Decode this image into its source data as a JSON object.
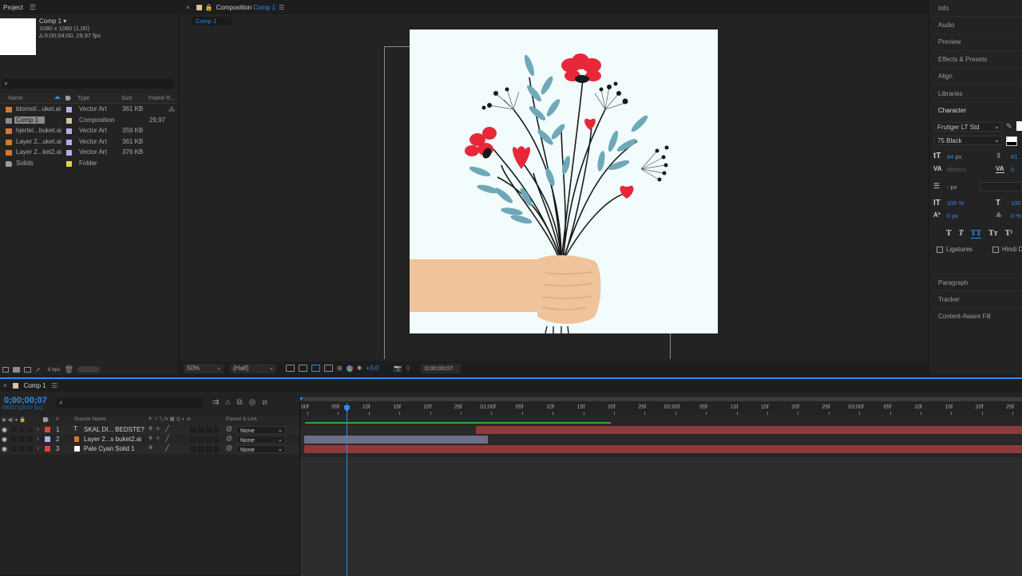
{
  "project": {
    "tab_label": "Project",
    "comp_name": "Comp 1 ▾",
    "comp_res": "1080 x 1080 (1,00)",
    "comp_dur": "Δ 0;00;04;00, 29,97 fps",
    "search_placeholder": "",
    "columns": {
      "name": "Name",
      "type": "Type",
      "size": "Size",
      "frame": "Frame R..."
    },
    "items": [
      {
        "name": "blomst/...uket.ai",
        "type": "Vector Art",
        "size": "361 KB",
        "fr": "",
        "color": "#b0b0e8",
        "icon": "vector-file-icon"
      },
      {
        "name": "Comp 1",
        "type": "Composition",
        "size": "",
        "fr": "29,97",
        "color": "#d8c49c",
        "icon": "composition-icon"
      },
      {
        "name": "hjerte/...buket.ai",
        "type": "Vector Art",
        "size": "359 KB",
        "fr": "",
        "color": "#b0b0e8",
        "icon": "vector-file-icon"
      },
      {
        "name": "Layer 2...uket.ai",
        "type": "Vector Art",
        "size": "361 KB",
        "fr": "",
        "color": "#b0b0e8",
        "icon": "vector-file-icon"
      },
      {
        "name": "Layer 2...ket2.ai",
        "type": "Vector Art",
        "size": "376 KB",
        "fr": "",
        "color": "#b0b0e8",
        "icon": "vector-file-icon"
      },
      {
        "name": "Solids",
        "type": "Folder",
        "size": "",
        "fr": "",
        "color": "#e6d048",
        "icon": "folder-icon"
      }
    ],
    "bpc": "8 bpc"
  },
  "composition": {
    "tab_prefix": "Composition",
    "tab_name": "Comp 1",
    "subtab": "Comp 1",
    "zoom": "50%",
    "resolution": "(Half)",
    "exposure": "+0,0",
    "timecode": "0;00;00;07"
  },
  "right_panels": {
    "items": [
      "Info",
      "Audio",
      "Preview",
      "Effects & Presets",
      "Align",
      "Libraries",
      "Character"
    ],
    "lower_items": [
      "Paragraph",
      "Tracker",
      "Content-Aware Fill"
    ]
  },
  "character": {
    "font": "Frutiger LT Std",
    "style": "75 Black",
    "size": "84",
    "size_unit": "px",
    "leading": "81",
    "kerning": "Metrics",
    "tracking": "0",
    "stroke_unit": "px",
    "stroke_value": "-",
    "v_scale": "100 %",
    "h_scale": "100",
    "baseline": "0 px",
    "tsume": "0 %",
    "style_buttons": [
      "T",
      "T",
      "TT",
      "Tт",
      "T¹"
    ],
    "ligatures": "Ligatures",
    "hindi": "Hindi D"
  },
  "timeline": {
    "tab_label": "Comp 1",
    "timecode": "0;00;00;07",
    "fps_info": "00007 (29.97 fps)",
    "columns": {
      "num": "#",
      "source": "Source Name",
      "parent": "Parent & Link"
    },
    "layers": [
      {
        "num": "1",
        "name": "SKAL DI... BEDSTE?",
        "parent": "None",
        "color": "#e04444",
        "type_icon": "T"
      },
      {
        "num": "2",
        "name": "Layer 2...s buket2.ai",
        "parent": "None",
        "color": "#b0b0e8",
        "type_icon": "ai"
      },
      {
        "num": "3",
        "name": "Pale Cyan Solid 1",
        "parent": "None",
        "color": "#e04444",
        "type_icon": "solid"
      }
    ],
    "ruler": [
      "00f",
      "05f",
      "10f",
      "15f",
      "20f",
      "25f",
      "01:00f",
      "05f",
      "10f",
      "15f",
      "20f",
      "25f",
      "02:00f",
      "05f",
      "10f",
      "15f",
      "20f",
      "25f",
      "03:00f",
      "05f",
      "10f",
      "15f",
      "20f",
      "25f"
    ],
    "playhead_frame": 7
  },
  "colors": {
    "accent": "#2d8ceb",
    "canvas_bg": "#f2fcfc",
    "flower_red": "#e8283a",
    "leaf": "#6fa8b8",
    "hand": "#efc49c"
  }
}
